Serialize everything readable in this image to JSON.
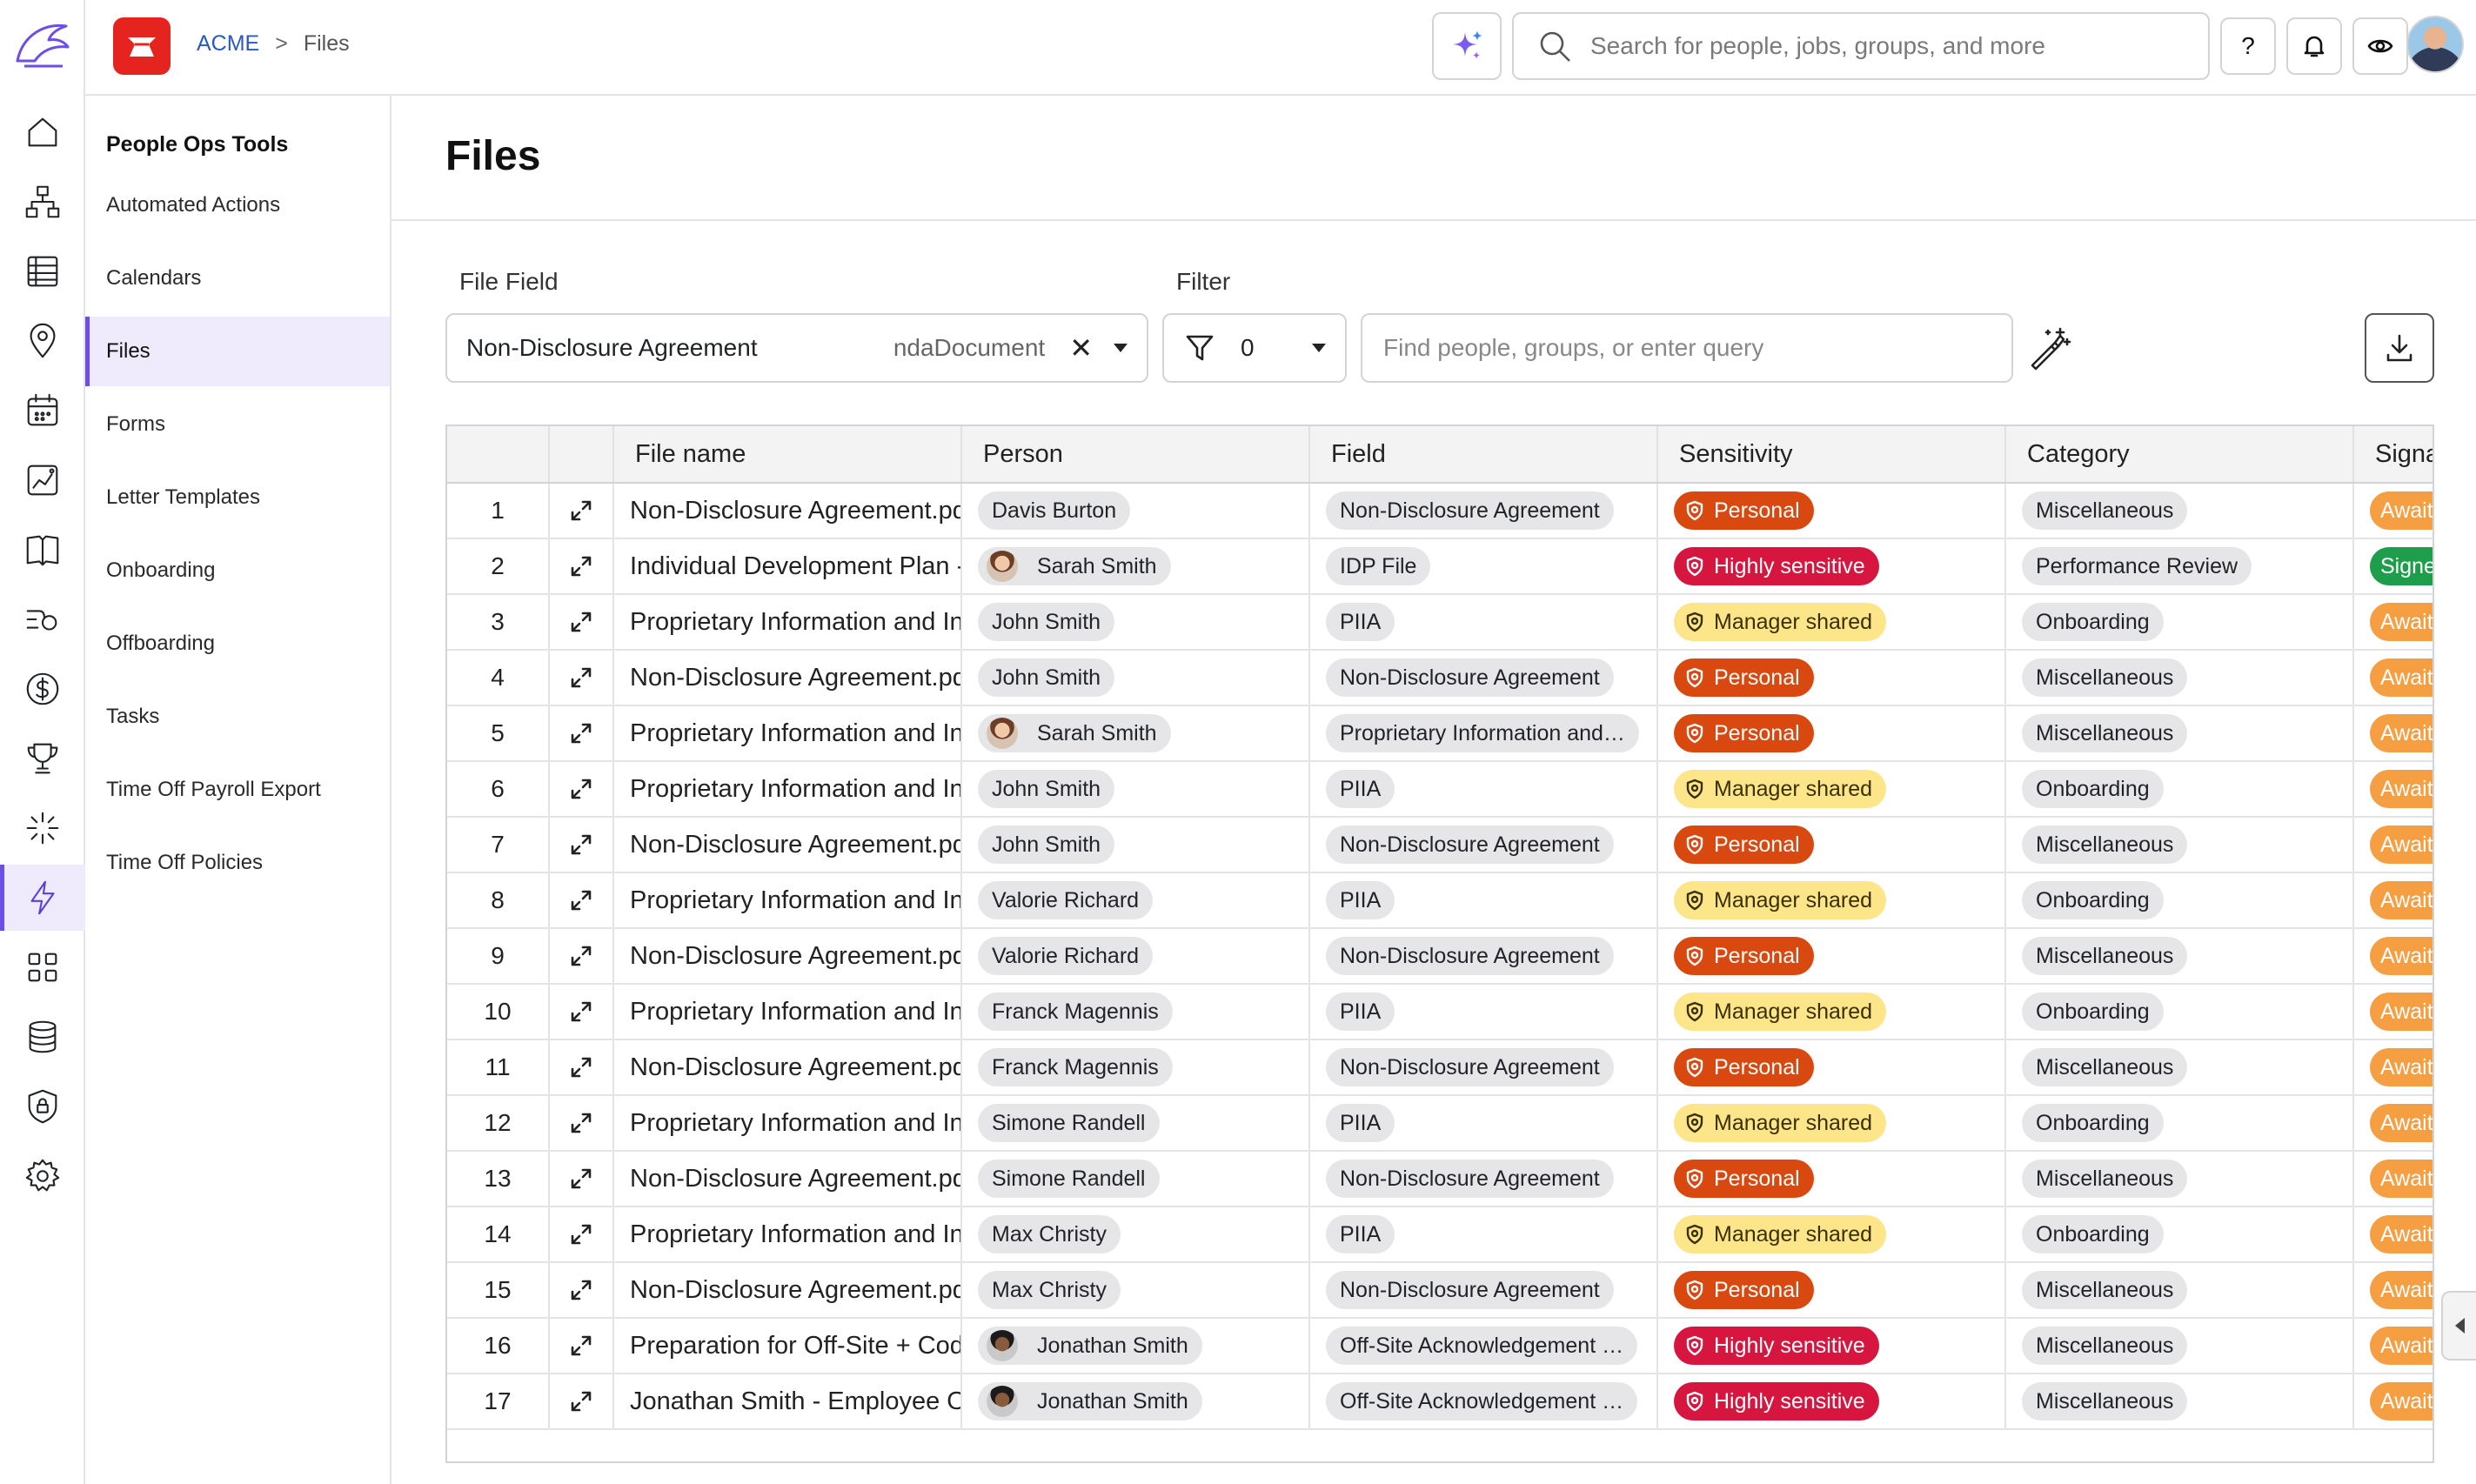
{
  "breadcrumb": {
    "root": "ACME",
    "separator": ">",
    "current": "Files"
  },
  "search": {
    "placeholder": "Search for people, jobs, groups, and more"
  },
  "topbar": {
    "help_label": "?"
  },
  "subnav": {
    "heading": "People Ops Tools",
    "items": [
      {
        "label": "Automated Actions"
      },
      {
        "label": "Calendars"
      },
      {
        "label": "Files",
        "active": true
      },
      {
        "label": "Forms"
      },
      {
        "label": "Letter Templates"
      },
      {
        "label": "Onboarding"
      },
      {
        "label": "Offboarding"
      },
      {
        "label": "Tasks"
      },
      {
        "label": "Time Off Payroll Export"
      },
      {
        "label": "Time Off Policies"
      }
    ]
  },
  "page": {
    "title": "Files"
  },
  "file_field": {
    "label": "File Field",
    "value": "Non-Disclosure Agreement",
    "key": "ndaDocument",
    "clear": "✕"
  },
  "filter": {
    "label": "Filter",
    "count": "0",
    "query_placeholder": "Find people, groups, or enter query"
  },
  "table": {
    "columns": [
      "File name",
      "Person",
      "Field",
      "Sensitivity",
      "Category",
      "Signa"
    ],
    "rows": [
      {
        "n": "1",
        "file": "Non-Disclosure Agreement.pdf",
        "person": "Davis Burton",
        "field": "Non-Disclosure Agreement",
        "sens": "Personal",
        "sens_type": "personal",
        "cat": "Miscellaneous",
        "sig": "Awaiting",
        "sig_type": "await"
      },
      {
        "n": "2",
        "file": "Individual Development Plan - Sarah Smith",
        "person": "Sarah Smith",
        "face": "f1",
        "field": "IDP File",
        "sens": "Highly sensitive",
        "sens_type": "high",
        "cat": "Performance Review",
        "sig": "Signed",
        "sig_type": "signed"
      },
      {
        "n": "3",
        "file": "Proprietary Information and Inventions",
        "person": "John Smith",
        "field": "PIIA",
        "sens": "Manager shared",
        "sens_type": "manager",
        "cat": "Onboarding",
        "sig": "Awaiting",
        "sig_type": "await"
      },
      {
        "n": "4",
        "file": "Non-Disclosure Agreement.pdf",
        "person": "John Smith",
        "field": "Non-Disclosure Agreement",
        "sens": "Personal",
        "sens_type": "personal",
        "cat": "Miscellaneous",
        "sig": "Awaiting",
        "sig_type": "await"
      },
      {
        "n": "5",
        "file": "Proprietary Information and Inventions",
        "person": "Sarah Smith",
        "face": "f1",
        "field": "Proprietary Information and…",
        "sens": "Personal",
        "sens_type": "personal",
        "cat": "Miscellaneous",
        "sig": "Awaiting",
        "sig_type": "await"
      },
      {
        "n": "6",
        "file": "Proprietary Information and Inventions",
        "person": "John Smith",
        "field": "PIIA",
        "sens": "Manager shared",
        "sens_type": "manager",
        "cat": "Onboarding",
        "sig": "Awaiting",
        "sig_type": "await"
      },
      {
        "n": "7",
        "file": "Non-Disclosure Agreement.pdf",
        "person": "John Smith",
        "field": "Non-Disclosure Agreement",
        "sens": "Personal",
        "sens_type": "personal",
        "cat": "Miscellaneous",
        "sig": "Awaiting",
        "sig_type": "await"
      },
      {
        "n": "8",
        "file": "Proprietary Information and Inventions",
        "person": "Valorie Richard",
        "field": "PIIA",
        "sens": "Manager shared",
        "sens_type": "manager",
        "cat": "Onboarding",
        "sig": "Awaiting",
        "sig_type": "await"
      },
      {
        "n": "9",
        "file": "Non-Disclosure Agreement.pdf",
        "person": "Valorie Richard",
        "field": "Non-Disclosure Agreement",
        "sens": "Personal",
        "sens_type": "personal",
        "cat": "Miscellaneous",
        "sig": "Awaiting",
        "sig_type": "await"
      },
      {
        "n": "10",
        "file": "Proprietary Information and Inventions",
        "person": "Franck Magennis",
        "field": "PIIA",
        "sens": "Manager shared",
        "sens_type": "manager",
        "cat": "Onboarding",
        "sig": "Awaiting",
        "sig_type": "await"
      },
      {
        "n": "11",
        "file": "Non-Disclosure Agreement.pdf",
        "person": "Franck Magennis",
        "field": "Non-Disclosure Agreement",
        "sens": "Personal",
        "sens_type": "personal",
        "cat": "Miscellaneous",
        "sig": "Awaiting",
        "sig_type": "await"
      },
      {
        "n": "12",
        "file": "Proprietary Information and Inventions",
        "person": "Simone Randell",
        "field": "PIIA",
        "sens": "Manager shared",
        "sens_type": "manager",
        "cat": "Onboarding",
        "sig": "Awaiting",
        "sig_type": "await"
      },
      {
        "n": "13",
        "file": "Non-Disclosure Agreement.pdf",
        "person": "Simone Randell",
        "field": "Non-Disclosure Agreement",
        "sens": "Personal",
        "sens_type": "personal",
        "cat": "Miscellaneous",
        "sig": "Awaiting",
        "sig_type": "await"
      },
      {
        "n": "14",
        "file": "Proprietary Information and Inventions",
        "person": "Max Christy",
        "field": "PIIA",
        "sens": "Manager shared",
        "sens_type": "manager",
        "cat": "Onboarding",
        "sig": "Awaiting",
        "sig_type": "await"
      },
      {
        "n": "15",
        "file": "Non-Disclosure Agreement.pdf",
        "person": "Max Christy",
        "field": "Non-Disclosure Agreement",
        "sens": "Personal",
        "sens_type": "personal",
        "cat": "Miscellaneous",
        "sig": "Awaiting",
        "sig_type": "await"
      },
      {
        "n": "16",
        "file": "Preparation for Off-Site + Code of Conduct",
        "person": "Jonathan Smith",
        "face": "f2",
        "field": "Off-Site Acknowledgement …",
        "sens": "Highly sensitive",
        "sens_type": "high",
        "cat": "Miscellaneous",
        "sig": "Awaiting",
        "sig_type": "await"
      },
      {
        "n": "17",
        "file": "Jonathan Smith - Employee Offer Letter",
        "person": "Jonathan Smith",
        "face": "f2",
        "field": "Off-Site Acknowledgement …",
        "sens": "Highly sensitive",
        "sens_type": "high",
        "cat": "Miscellaneous",
        "sig": "Awaiting",
        "sig_type": "await"
      }
    ]
  }
}
